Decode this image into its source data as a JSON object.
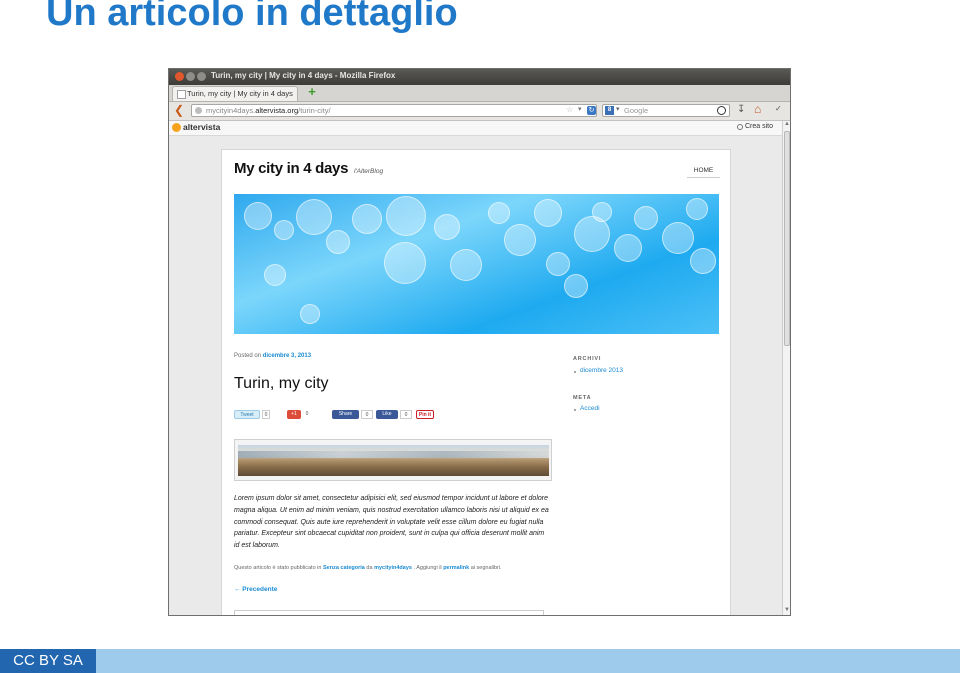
{
  "slide": {
    "title": "Un articolo in dettaglio",
    "footer_license": "CC BY SA"
  },
  "browser": {
    "window_title": "Turin, my city | My city in 4 days - Mozilla Firefox",
    "tab_label": "Turin, my city | My city in 4 days",
    "new_tab_symbol": "+",
    "url_prefix": "mycityin4days.",
    "url_domain": "altervista.org",
    "url_path": "/turin-city/",
    "search_placeholder": "Google",
    "search_engine_letter": "8"
  },
  "altervista_bar": {
    "logo": "altervista",
    "create_site": "Crea sito"
  },
  "blog": {
    "title": "My city in 4 days",
    "subtitle": "l'AlterBlog",
    "nav_home": "HOME",
    "posted_on_prefix": "Posted on",
    "posted_on_date": "dicembre 3, 2013",
    "post_title": "Turin, my city",
    "share": {
      "tweet": "Tweet",
      "tweet_count": "0",
      "gplus": "+1",
      "gplus_count": "0",
      "fb_share": "Share",
      "fb_share_count": "0",
      "fb_like": "Like",
      "fb_like_count": "0",
      "pinterest": "Pin it"
    },
    "body_lines": [
      "Lorem ipsum dolor sit amet, consectetur adipisici elit, sed eiusmod tempor incidunt ut labore et dolore",
      "magna aliqua. Ut enim ad minim veniam, quis nostrud exercitation ullamco laboris nisi ut aliquid ex ea",
      "commodi consequat. Quis aute iure reprehenderit in voluptate velit esse cillum dolore eu fugiat nulla",
      "pariatur. Excepteur sint obcaecat cupiditat non proident, sunt in culpa qui officia deserunt mollit anim",
      "id est laborum."
    ],
    "meta_prefix": "Questo articolo è stato pubblicato in",
    "meta_category": "Senza categoria",
    "meta_by": "da",
    "meta_author": "mycityin4days",
    "meta_mid": ". Aggiungi il",
    "meta_permalink": "permalink",
    "meta_suffix": "ai segnalibri.",
    "previous_link": "← Precedente"
  },
  "sidebar": {
    "archive_title": "ARCHIVI",
    "archive_item": "dicembre 2013",
    "meta_title": "META",
    "meta_item": "Accedi"
  },
  "colors": {
    "slide_title": "#1f79c8",
    "footer_label_bg": "#2266b0",
    "footer_bar_bg": "#9ecaec",
    "link": "#1b8bd2"
  }
}
